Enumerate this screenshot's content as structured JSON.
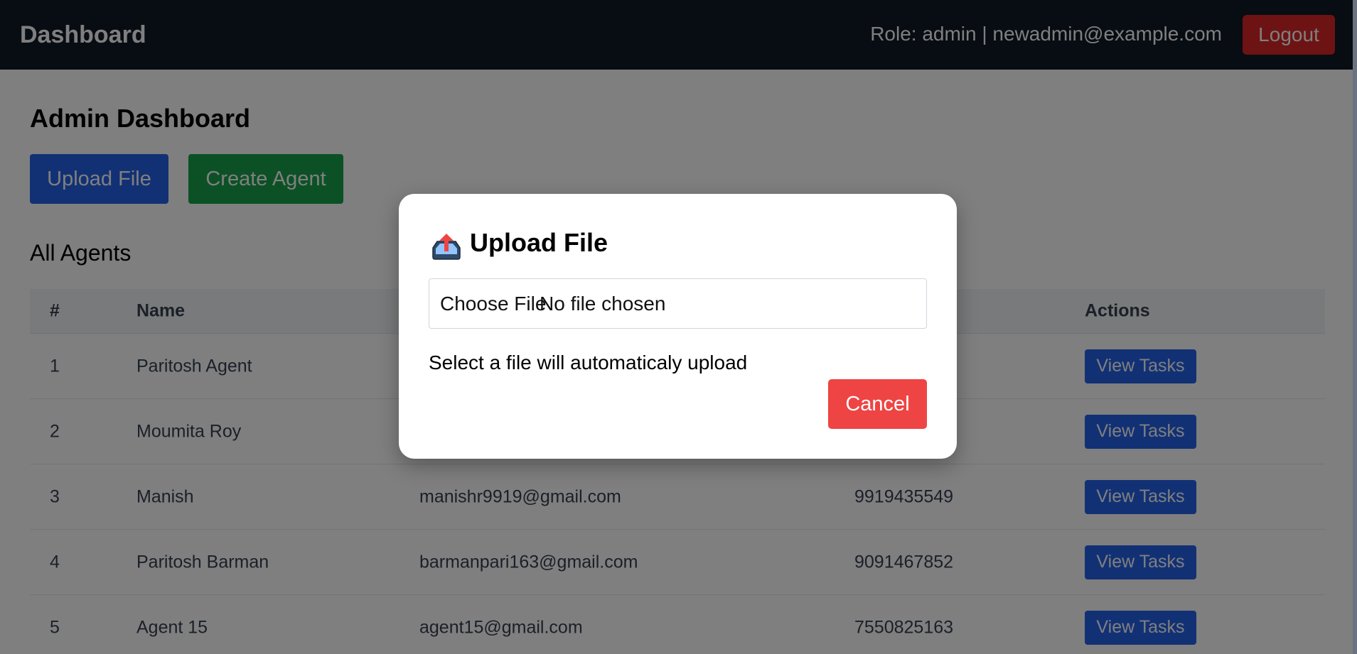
{
  "navbar": {
    "brand": "Dashboard",
    "role_text": "Role: admin | newadmin@example.com",
    "logout_label": "Logout"
  },
  "page": {
    "title": "Admin Dashboard",
    "upload_label": "Upload File",
    "create_label": "Create Agent",
    "section_title": "All Agents"
  },
  "table": {
    "headers": [
      "#",
      "Name",
      "",
      "",
      "Actions"
    ],
    "rows": [
      {
        "num": "1",
        "name": "Paritosh Agent",
        "email": "",
        "phone": "",
        "action": "View Tasks"
      },
      {
        "num": "2",
        "name": "Moumita Roy",
        "email": "",
        "phone": "",
        "action": "View Tasks"
      },
      {
        "num": "3",
        "name": "Manish",
        "email": "manishr9919@gmail.com",
        "phone": "9919435549",
        "action": "View Tasks"
      },
      {
        "num": "4",
        "name": "Paritosh Barman",
        "email": "barmanpari163@gmail.com",
        "phone": "9091467852",
        "action": "View Tasks"
      },
      {
        "num": "5",
        "name": "Agent 15",
        "email": "agent15@gmail.com",
        "phone": "7550825163",
        "action": "View Tasks"
      }
    ]
  },
  "modal": {
    "icon": "upload-tray-icon",
    "title": "Upload File",
    "choose_label": "Choose File",
    "file_status": "No file chosen",
    "hint": "Select a file will automaticaly upload",
    "cancel_label": "Cancel"
  },
  "colors": {
    "navbar": "#111827",
    "primary": "#2563eb",
    "success": "#16a34a",
    "danger": "#ef4444"
  }
}
